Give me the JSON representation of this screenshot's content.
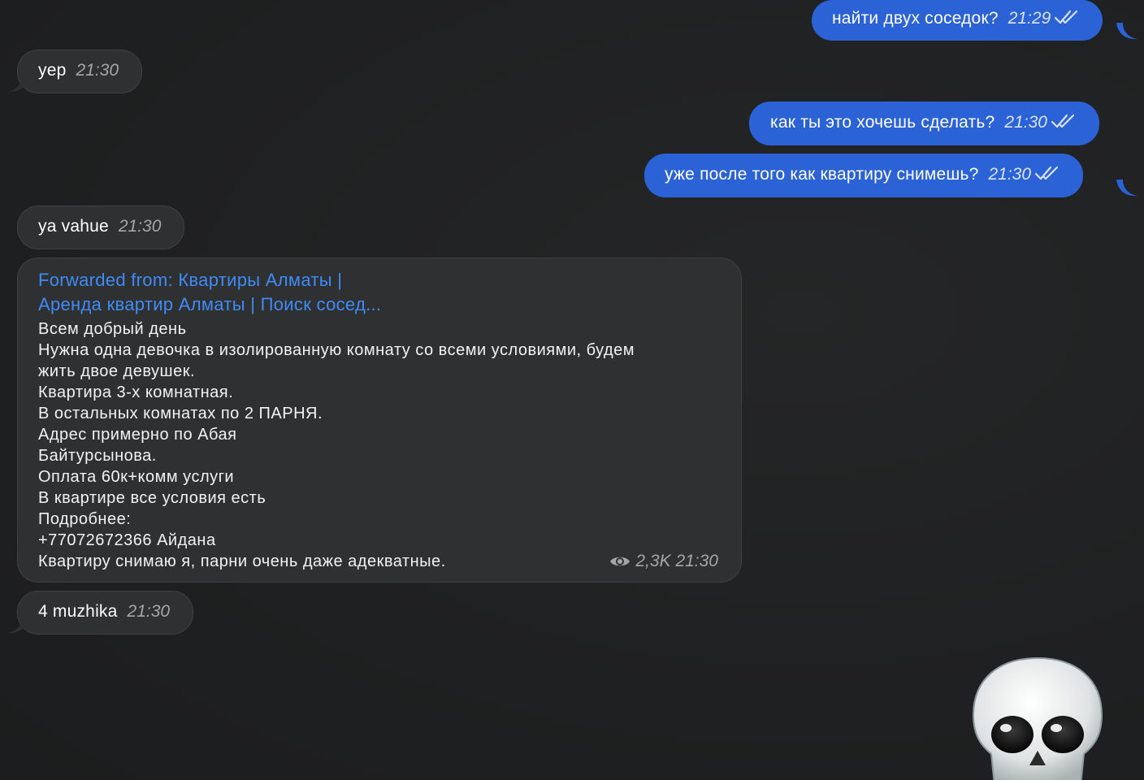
{
  "messages": [
    {
      "id": "m1",
      "direction": "out",
      "text": "найти двух соседок?",
      "time": "21:29",
      "status": "read"
    },
    {
      "id": "m2",
      "direction": "in",
      "text": "yep",
      "time": "21:30"
    },
    {
      "id": "m3",
      "direction": "out",
      "text": "как ты это хочешь сделать?",
      "time": "21:30",
      "status": "read"
    },
    {
      "id": "m4",
      "direction": "out",
      "text": "уже после того как квартиру снимешь?",
      "time": "21:30",
      "status": "read"
    },
    {
      "id": "m5",
      "direction": "in",
      "text": "ya vahue",
      "time": "21:30"
    },
    {
      "id": "m6",
      "direction": "in",
      "forwarded": {
        "prefix": "Forwarded from:",
        "source_line1": "Квартиры Алматы |",
        "source_line2": "Аренда квартир Алматы | Поиск сосед..."
      },
      "lines": [
        "Всем добрый день",
        "Нужна одна девочка в изолированную комнату со всеми условиями, будем",
        "жить двое девушек.",
        "Квартира 3-х комнатная.",
        "В остальных комнатах по 2 ПАРНЯ.",
        "Адрес примерно по Абая",
        "Байтурсынова.",
        "Оплата 60к+комм услуги",
        "В квартире все условия есть",
        "Подробнее:",
        "+77072672366 Айдана",
        "Квартиру снимаю я, парни очень даже адекватные."
      ],
      "views": "2,3K",
      "time": "21:30"
    },
    {
      "id": "m7",
      "direction": "in",
      "text": "4 muzhika",
      "time": "21:30"
    }
  ],
  "sticker": {
    "emoji": "skull",
    "icon": "skull-icon"
  },
  "colors": {
    "background": "#202122",
    "outgoing_bubble": "#2b62d6",
    "incoming_bubble": "#2f3031",
    "forward_link": "#3f8bf7"
  }
}
